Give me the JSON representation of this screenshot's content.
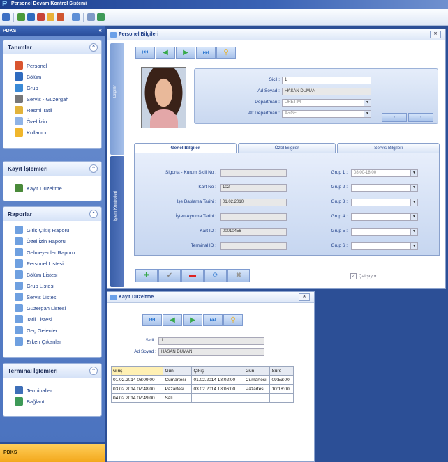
{
  "app": {
    "title": "Personel Devam Kontrol Sistemi",
    "logo": "P"
  },
  "toolbar_icons": [
    "open-icon",
    "chart-icon",
    "list-icon",
    "edit-icon",
    "calendar-icon",
    "search-icon",
    "window-icon",
    "settings-icon",
    "network-icon"
  ],
  "nav": {
    "header": "PDKS",
    "groups": [
      {
        "title": "Tanımlar",
        "items": [
          "Personel",
          "Bölüm",
          "Grup",
          "Servis - Güzergah",
          "Resmi Tatil",
          "Özel İzin",
          "Kullanıcı"
        ]
      },
      {
        "title": "Kayıt İşlemleri",
        "items": [
          "Kayıt Düzeltme"
        ]
      },
      {
        "title": "Raporlar",
        "items": [
          "Giriş Çıkış Raporu",
          "Özel İzin Raporu",
          "Gelmeyenler Raporu",
          "Personel Listesi",
          "Bölüm Listesi",
          "Grup Listesi",
          "Servis Listesi",
          "Güzergah Listesi",
          "Tatil Listesi",
          "Geç Gelenler",
          "Erken Çıkanlar"
        ]
      },
      {
        "title": "Terminal İşlemleri",
        "items": [
          "Terminaller",
          "Bağlantı"
        ]
      }
    ],
    "footer": "PDKS"
  },
  "personel": {
    "title": "Personel Bilgileri",
    "side_top": "Bilgiler",
    "side_bottom": "İşlem Kontrolleri",
    "labels": {
      "sicil": "Sicil :",
      "ad_soyad": "Ad Soyad :",
      "departman": "Departman :",
      "alt_departman": "Alt Departman :"
    },
    "values": {
      "sicil": "1",
      "ad_soyad": "HASAN DUMAN",
      "departman": "ÜRETİM",
      "alt_departman": "ARGE"
    },
    "page_buttons": [
      "‹",
      "›"
    ],
    "tabs": [
      "Genel Bilgiler",
      "Özel Bilgiler",
      "Servis Bilgileri"
    ],
    "form_labels": [
      "Sigorta - Kurum Sicil No :",
      "Kart No :",
      "İşe Başlama Tarihi :",
      "İşten Ayrılma Tarihi :",
      "Kart ID :",
      "Terminal ID :"
    ],
    "form_values": [
      "",
      "102",
      "01.02.2010",
      "",
      "00010456",
      ""
    ],
    "grup_labels": [
      "Grup 1 :",
      "Grup 2 :",
      "Grup 3 :",
      "Grup 4 :",
      "Grup 5 :",
      "Grup 6 :"
    ],
    "grup_values": [
      "08:00-18:00",
      "",
      "",
      "",
      "",
      ""
    ],
    "calisiyor": "Çalışıyor"
  },
  "kayit": {
    "title": "Kayıt Düzeltme",
    "labels": {
      "sicil": "Sicil :",
      "ad_soyad": "Ad Soyad :"
    },
    "values": {
      "sicil": "1",
      "ad_soyad": "HASAN DUMAN"
    },
    "columns": [
      "Giriş",
      "Gün",
      "Çıkış",
      "Gün",
      "Süre"
    ],
    "rows": [
      [
        "01.02.2014 08:09:00",
        "Cumartesi",
        "01.02.2014 18:02:00",
        "Cumartesi",
        "09:53:00"
      ],
      [
        "03.02.2014 07:48:00",
        "Pazartesi",
        "03.02.2014 18:06:00",
        "Pazartesi",
        "10:18:00"
      ],
      [
        "04.02.2014 07:49:00",
        "Salı",
        "",
        "",
        ""
      ]
    ]
  },
  "colors": {
    "accent": "#2b4f9c",
    "highlight": "#fff0b3",
    "footer": "#f3a81c"
  }
}
